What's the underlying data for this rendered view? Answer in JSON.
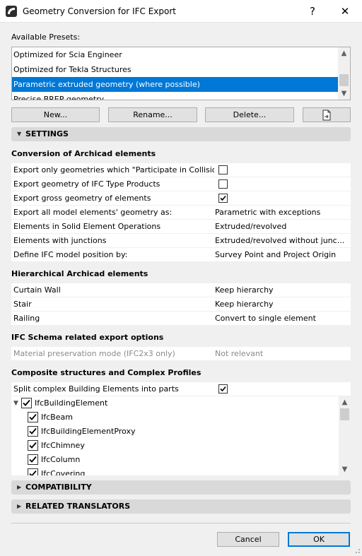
{
  "window": {
    "title": "Geometry Conversion for IFC Export",
    "help_label": "?",
    "close_label": "✕",
    "app_icon": "archicad-logo-icon"
  },
  "presets": {
    "label": "Available Presets:",
    "items": [
      {
        "label": "Optimized for Scia Engineer",
        "selected": false
      },
      {
        "label": "Optimized for Tekla Structures",
        "selected": false
      },
      {
        "label": "Parametric extruded geometry (where possible)",
        "selected": true
      },
      {
        "label": "Precise BREP geometry",
        "selected": false
      }
    ],
    "buttons": {
      "new": "New...",
      "rename": "Rename...",
      "delete": "Delete...",
      "import_icon": "import-preset-icon"
    }
  },
  "sections": {
    "settings": "SETTINGS",
    "compatibility": "COMPATIBILITY",
    "related_translators": "RELATED TRANSLATORS"
  },
  "conversion": {
    "title": "Conversion of Archicad elements",
    "rows": [
      {
        "label": "Export only geometries which \"Participate in Collision...",
        "checkbox": true,
        "checked": false
      },
      {
        "label": "Export geometry of IFC Type Products",
        "checkbox": true,
        "checked": false
      },
      {
        "label": "Export gross geometry of elements",
        "checkbox": true,
        "checked": true
      },
      {
        "label": "Export all model elements' geometry as:",
        "value": "Parametric with exceptions"
      },
      {
        "label": "Elements in Solid Element Operations",
        "value": "Extruded/revolved"
      },
      {
        "label": "Elements with junctions",
        "value": "Extruded/revolved without junc..."
      },
      {
        "label": "Define IFC model position by:",
        "value": "Survey Point and Project Origin"
      }
    ]
  },
  "hierarchical": {
    "title": "Hierarchical Archicad elements",
    "rows": [
      {
        "label": "Curtain Wall",
        "value": "Keep hierarchy"
      },
      {
        "label": "Stair",
        "value": "Keep hierarchy"
      },
      {
        "label": "Railing",
        "value": "Convert to single element"
      }
    ]
  },
  "schema": {
    "title": "IFC Schema related export options",
    "rows": [
      {
        "label": "Material preservation mode (IFC2x3 only)",
        "value": "Not relevant",
        "disabled": true
      }
    ]
  },
  "composite": {
    "title": "Composite structures and Complex Profiles",
    "split_label": "Split complex Building Elements into parts",
    "split_checked": true,
    "tree": [
      {
        "label": "IfcBuildingElement",
        "level": 0,
        "checked": true,
        "expanded": true
      },
      {
        "label": "IfcBeam",
        "level": 1,
        "checked": true
      },
      {
        "label": "IfcBuildingElementProxy",
        "level": 1,
        "checked": true
      },
      {
        "label": "IfcChimney",
        "level": 1,
        "checked": true
      },
      {
        "label": "IfcColumn",
        "level": 1,
        "checked": true
      },
      {
        "label": "IfcCovering",
        "level": 1,
        "checked": true
      }
    ]
  },
  "footer": {
    "cancel": "Cancel",
    "ok": "OK"
  },
  "colors": {
    "selection": "#0078d7",
    "header_bg": "#d9d9d9",
    "window_bg": "#f0f0f0",
    "ok_border": "#0078d7"
  }
}
